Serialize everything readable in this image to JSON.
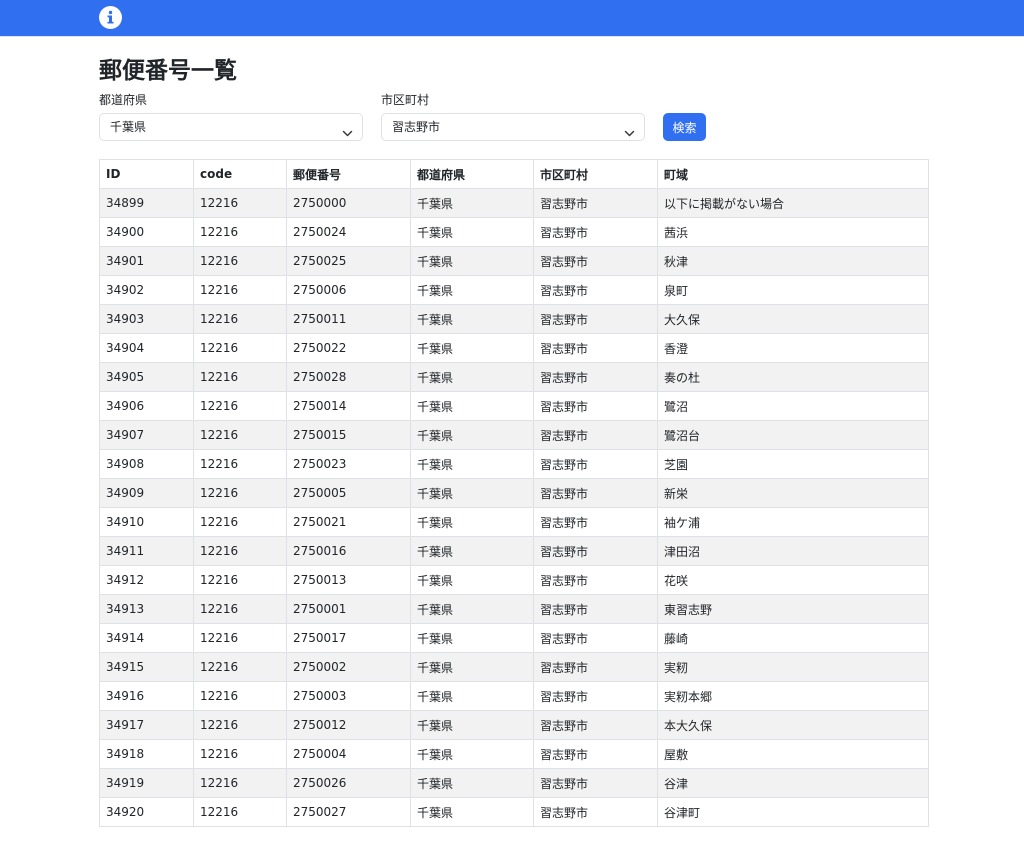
{
  "header": {
    "icon": "info-icon"
  },
  "page": {
    "title": "郵便番号一覧"
  },
  "filters": {
    "prefecture_label": "都道府県",
    "prefecture_value": "千葉県",
    "city_label": "市区町村",
    "city_value": "習志野市",
    "search_button": "検索"
  },
  "table": {
    "columns": [
      "ID",
      "code",
      "郵便番号",
      "都道府県",
      "市区町村",
      "町域"
    ],
    "rows": [
      [
        "34899",
        "12216",
        "2750000",
        "千葉県",
        "習志野市",
        "以下に掲載がない場合"
      ],
      [
        "34900",
        "12216",
        "2750024",
        "千葉県",
        "習志野市",
        "茜浜"
      ],
      [
        "34901",
        "12216",
        "2750025",
        "千葉県",
        "習志野市",
        "秋津"
      ],
      [
        "34902",
        "12216",
        "2750006",
        "千葉県",
        "習志野市",
        "泉町"
      ],
      [
        "34903",
        "12216",
        "2750011",
        "千葉県",
        "習志野市",
        "大久保"
      ],
      [
        "34904",
        "12216",
        "2750022",
        "千葉県",
        "習志野市",
        "香澄"
      ],
      [
        "34905",
        "12216",
        "2750028",
        "千葉県",
        "習志野市",
        "奏の杜"
      ],
      [
        "34906",
        "12216",
        "2750014",
        "千葉県",
        "習志野市",
        "鷺沼"
      ],
      [
        "34907",
        "12216",
        "2750015",
        "千葉県",
        "習志野市",
        "鷺沼台"
      ],
      [
        "34908",
        "12216",
        "2750023",
        "千葉県",
        "習志野市",
        "芝園"
      ],
      [
        "34909",
        "12216",
        "2750005",
        "千葉県",
        "習志野市",
        "新栄"
      ],
      [
        "34910",
        "12216",
        "2750021",
        "千葉県",
        "習志野市",
        "袖ケ浦"
      ],
      [
        "34911",
        "12216",
        "2750016",
        "千葉県",
        "習志野市",
        "津田沼"
      ],
      [
        "34912",
        "12216",
        "2750013",
        "千葉県",
        "習志野市",
        "花咲"
      ],
      [
        "34913",
        "12216",
        "2750001",
        "千葉県",
        "習志野市",
        "東習志野"
      ],
      [
        "34914",
        "12216",
        "2750017",
        "千葉県",
        "習志野市",
        "藤崎"
      ],
      [
        "34915",
        "12216",
        "2750002",
        "千葉県",
        "習志野市",
        "実籾"
      ],
      [
        "34916",
        "12216",
        "2750003",
        "千葉県",
        "習志野市",
        "実籾本郷"
      ],
      [
        "34917",
        "12216",
        "2750012",
        "千葉県",
        "習志野市",
        "本大久保"
      ],
      [
        "34918",
        "12216",
        "2750004",
        "千葉県",
        "習志野市",
        "屋敷"
      ],
      [
        "34919",
        "12216",
        "2750026",
        "千葉県",
        "習志野市",
        "谷津"
      ],
      [
        "34920",
        "12216",
        "2750027",
        "千葉県",
        "習志野市",
        "谷津町"
      ]
    ]
  },
  "colors": {
    "accent": "#2f6ff0",
    "stripe": "#f2f2f2",
    "border": "#dee2e6"
  }
}
